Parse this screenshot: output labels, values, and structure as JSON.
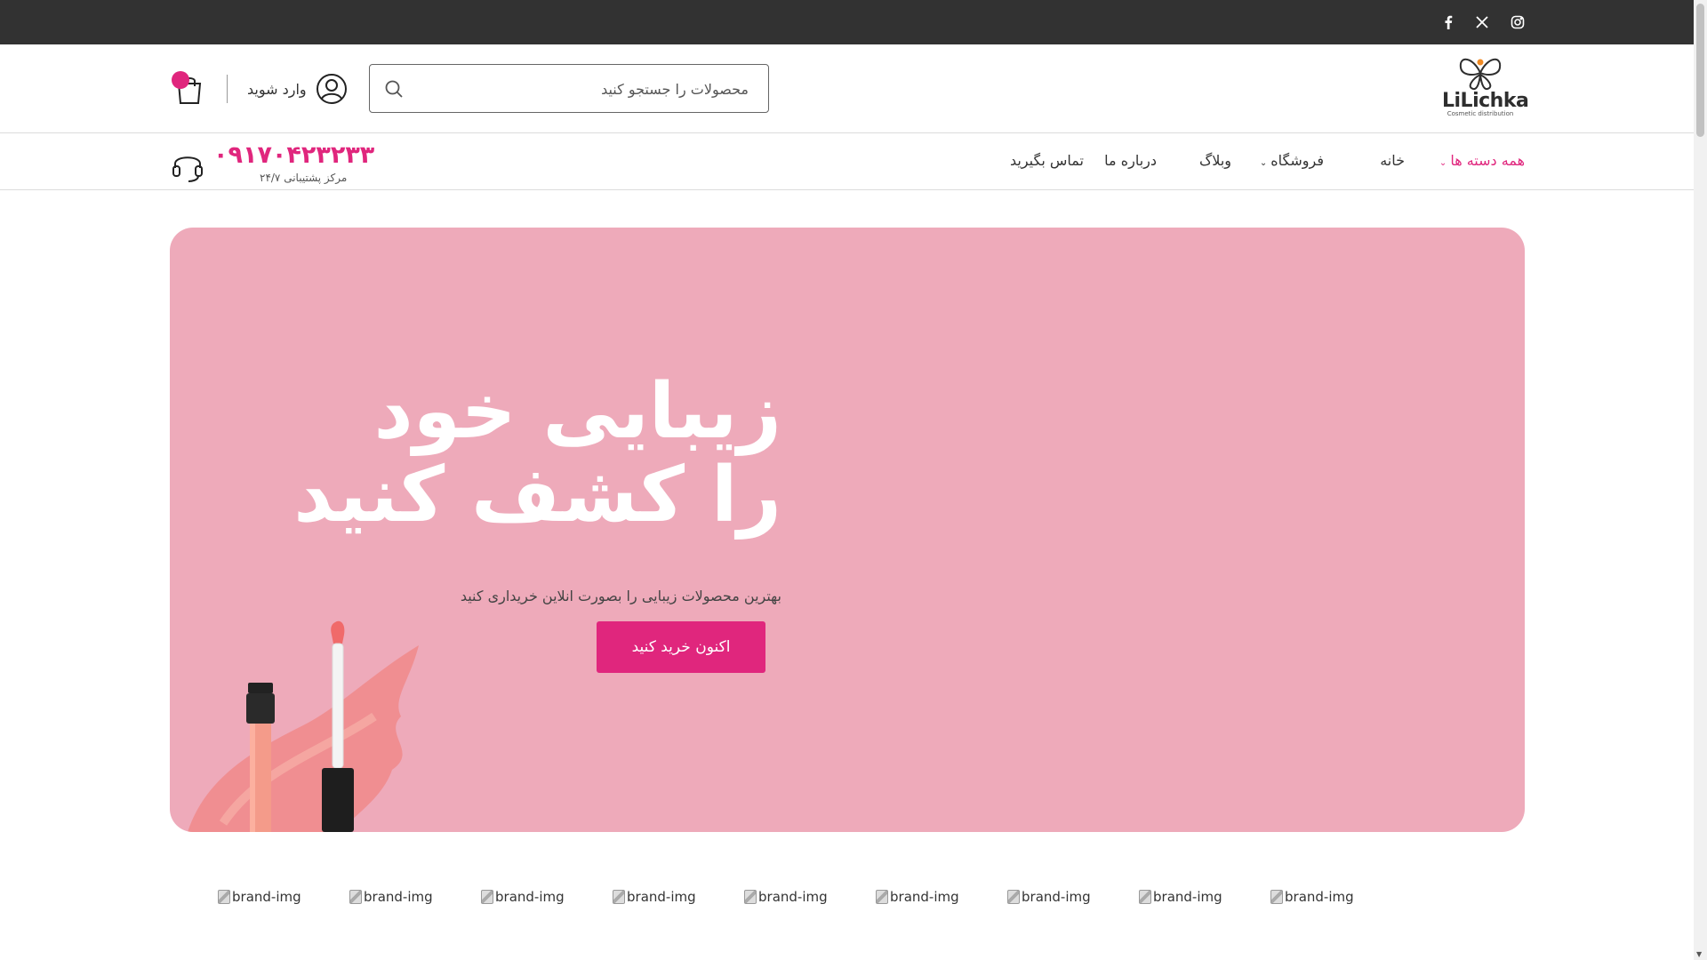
{
  "topbar": {
    "social": [
      {
        "name": "instagram",
        "glyph": "◎"
      },
      {
        "name": "x",
        "glyph": "𝕏"
      },
      {
        "name": "facebook",
        "glyph": "f"
      }
    ]
  },
  "header": {
    "logo": {
      "text": "LiLichka",
      "subtitle": "Cosmetic distribution"
    },
    "search": {
      "placeholder": "محصولات را جستجو کنید"
    },
    "login_label": "وارد شوید"
  },
  "nav": {
    "items": [
      {
        "label": "همه دسته ها",
        "active": true,
        "dropdown": true
      },
      {
        "label": "خانه",
        "active": false,
        "dropdown": false
      },
      {
        "label": "فروشگاه",
        "active": false,
        "dropdown": true
      },
      {
        "label": "وبلاگ",
        "active": false,
        "dropdown": false
      },
      {
        "label": "درباره ما",
        "active": false,
        "dropdown": false
      },
      {
        "label": "تماس بگیرید",
        "active": false,
        "dropdown": false
      }
    ],
    "support": {
      "phone": "۰۹۱۷۰۴۲۳۲۳۳",
      "label": "مرکز پشتیبانی ۲۴/۷"
    }
  },
  "hero": {
    "title": "زیبایی خود را کشف کنید",
    "subtitle": "بهترین محصولات زیبایی را بصورت انلاین خریداری کنید",
    "button_label": "اکنون خرید کنید"
  },
  "brands": {
    "alts": [
      "brand-img",
      "brand-img",
      "brand-img",
      "brand-img",
      "brand-img",
      "brand-img",
      "brand-img",
      "brand-img",
      "brand-img"
    ]
  },
  "colors": {
    "accent": "#e0267d",
    "hero_bg": "#eeaaba",
    "topbar_bg": "#323232"
  }
}
